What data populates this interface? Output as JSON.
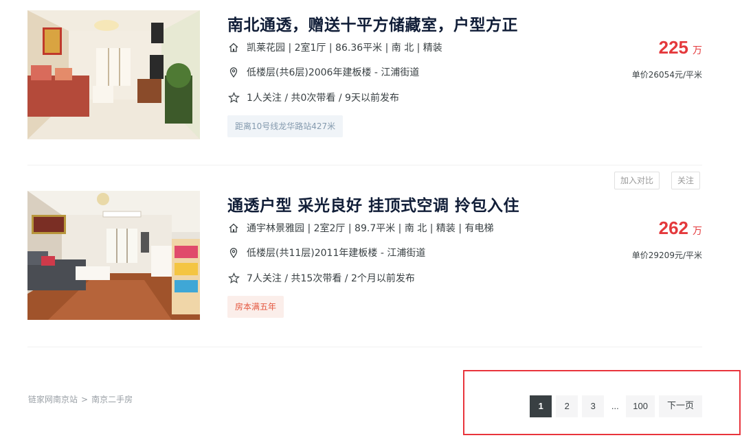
{
  "listings": [
    {
      "title": "南北通透，赠送十平方储藏室，户型方正",
      "house_info": "凯莱花园 | 2室1厅 | 86.36平米 | 南 北 | 精装",
      "position_info": "低楼层(共6层)2006年建板楼 - 江浦街道",
      "follow_info": "1人关注 / 共0次带看 / 9天以前发布",
      "tag": "距离10号线龙华路站427米",
      "price": "225",
      "price_unit": "万",
      "unit_price": "单价26054元/平米",
      "icons": {
        "house": "house-icon",
        "position": "location-pin-icon",
        "follow": "star-icon"
      }
    },
    {
      "title": "通透户型 采光良好 挂顶式空调 拎包入住",
      "house_info": "通宇林景雅园 | 2室2厅 | 89.7平米 | 南 北 | 精装 | 有电梯",
      "position_info": "低楼层(共11层)2011年建板楼 - 江浦街道",
      "follow_info": "7人关注 / 共15次带看 / 2个月以前发布",
      "tag": "房本满五年",
      "price": "262",
      "price_unit": "万",
      "unit_price": "单价29209元/平米",
      "actions": {
        "compare": "加入对比",
        "follow": "关注"
      }
    }
  ],
  "breadcrumb": {
    "home": "链家网南京站",
    "separator": ">",
    "current": "南京二手房"
  },
  "pagination": {
    "pages": [
      "1",
      "2",
      "3"
    ],
    "ellipsis": "...",
    "last": "100",
    "next": "下一页",
    "current_page": 1
  },
  "colors": {
    "price": "#e4393c",
    "title": "#101d37",
    "active_page": "#394043",
    "highlight": "#e8343c"
  }
}
